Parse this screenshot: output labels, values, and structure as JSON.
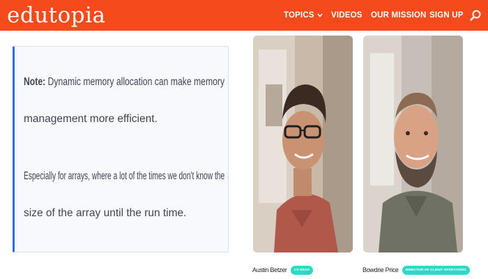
{
  "header": {
    "logo": "edutopia",
    "nav": [
      {
        "label": "TOPICS",
        "has_dropdown": true
      },
      {
        "label": "VIDEOS"
      },
      {
        "label": "OUR MISSION"
      },
      {
        "label": "SIGN UP"
      }
    ],
    "search_icon": "search-icon",
    "bg_color": "#f54a1c"
  },
  "note": {
    "bold_label": "Note:",
    "line1_rest": " Dynamic memory allocation can make memory",
    "line2": "management more efficient.",
    "line3": "Especially for arrays, where a lot of the times we don't know the",
    "line4": "size of the array until the run time.",
    "accent_color": "#2f6fdb"
  },
  "people": [
    {
      "name": "Austin Betzer",
      "role": "CS HEAD"
    },
    {
      "name": "Bowdrie Price",
      "role": "DIRECTOR OF CLIENT OPERATIONS"
    }
  ],
  "badge_color": "#2dd9c6"
}
